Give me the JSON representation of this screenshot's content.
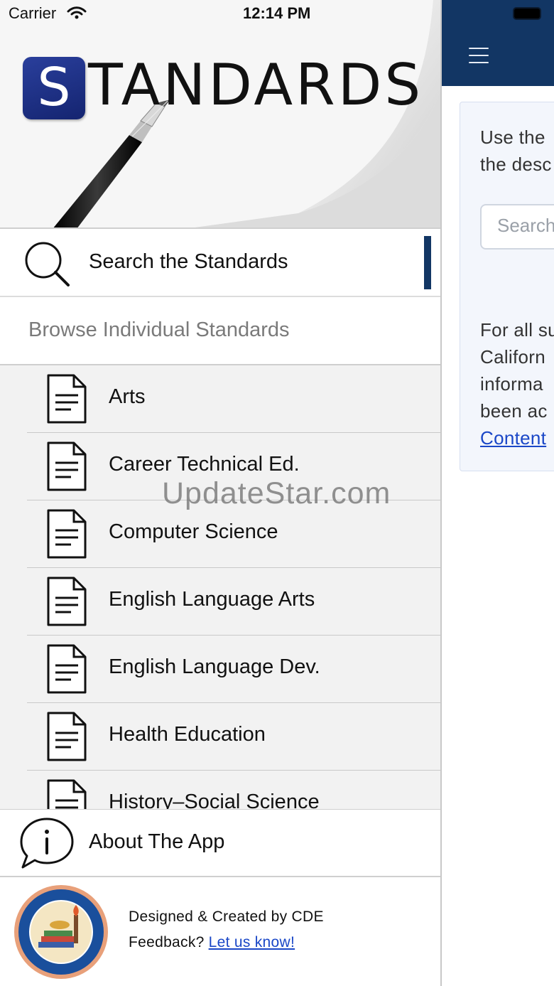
{
  "status_bar": {
    "carrier": "Carrier",
    "time": "12:14 PM"
  },
  "banner": {
    "logo_letter": "S",
    "logo_word": "TANDARDS"
  },
  "menu": {
    "search_label": "Search the Standards",
    "browse_header": "Browse Individual Standards",
    "subjects": [
      "Arts",
      "Career Technical Ed.",
      "Computer Science",
      "English Language Arts",
      "English Language Dev.",
      "Health Education",
      "History–Social Science"
    ],
    "about_label": "About The App"
  },
  "footer": {
    "designed_by": "Designed & Created by CDE",
    "feedback_prefix": "Feedback?",
    "feedback_link": "Let us know!"
  },
  "background_page": {
    "intro_line1": "Use the",
    "intro_line2": "the desc",
    "search_placeholder": "Search",
    "para_line1": "For all su",
    "para_line2": "Californ",
    "para_line3": "informa",
    "para_line4": "been ac",
    "para_link": "Content"
  },
  "watermark": "UpdateStar.com",
  "colors": {
    "header_navy": "#123664",
    "link_blue": "#1a47c7",
    "list_background": "#f2f2f2"
  },
  "icons": {
    "search": "search-icon",
    "document": "document-icon",
    "info": "info-bubble-icon",
    "menu": "hamburger-icon",
    "wifi": "wifi-icon"
  }
}
